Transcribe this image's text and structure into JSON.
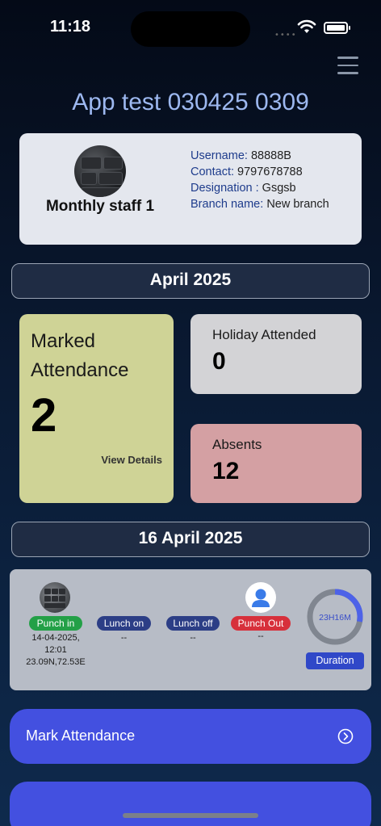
{
  "status_bar": {
    "time": "11:18"
  },
  "header": {
    "title": "App test 030425 0309"
  },
  "profile": {
    "name": "Monthly staff 1",
    "username_label": "Username:",
    "username": "88888B",
    "contact_label": "Contact:",
    "contact": "9797678788",
    "designation_label": "Designation :",
    "designation": "Gsgsb",
    "branch_label": "Branch name:",
    "branch": "New branch"
  },
  "month_header": "April 2025",
  "stats": {
    "marked_label_1": "Marked",
    "marked_label_2": "Attendance",
    "marked_value": "2",
    "view_details": "View Details",
    "holiday_label": "Holiday Attended",
    "holiday_value": "0",
    "absents_label": "Absents",
    "absents_value": "12"
  },
  "day_header": "16 April 2025",
  "punch": {
    "punch_in_label": "Punch in",
    "punch_in_date": "14-04-2025,",
    "punch_in_time": "12:01",
    "punch_in_location": "23.09N,72.53E",
    "lunch_on_label": "Lunch on",
    "lunch_on_value": "--",
    "lunch_off_label": "Lunch off",
    "lunch_off_value": "--",
    "punch_out_label": "Punch Out",
    "punch_out_value": "--",
    "duration_value": "23H16M",
    "duration_label": "Duration",
    "duration_fraction": 0.28
  },
  "actions": {
    "mark_attendance": "Mark Attendance"
  },
  "colors": {
    "accent": "#4350e0",
    "marked_tile": "#cfd396",
    "holiday_tile": "#d3d3d6",
    "absent_tile": "#d4a0a3",
    "punch_in": "#23a047",
    "punch_out": "#d7303b"
  }
}
